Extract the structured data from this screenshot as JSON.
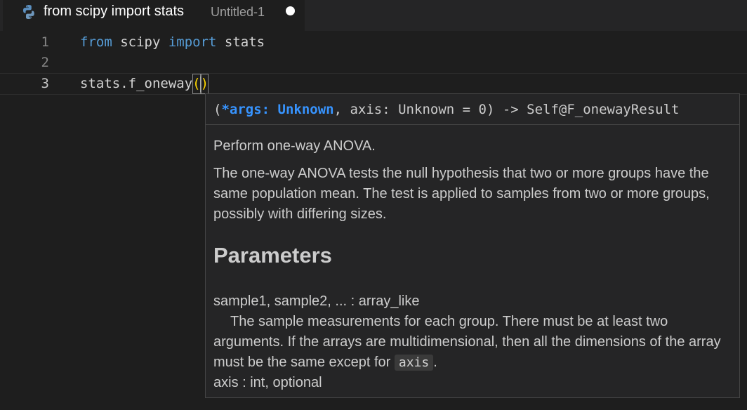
{
  "tab": {
    "title": "from scipy import stats",
    "description": "Untitled-1",
    "icon": "python-icon",
    "dirty": true
  },
  "editor": {
    "lines": [
      {
        "number": "1",
        "tokens": [
          {
            "text": "from",
            "kind": "keyword"
          },
          {
            "text": " scipy ",
            "kind": "plain"
          },
          {
            "text": "import",
            "kind": "keyword"
          },
          {
            "text": " stats",
            "kind": "plain"
          }
        ]
      },
      {
        "number": "2",
        "tokens": []
      },
      {
        "number": "3",
        "tokens": [
          {
            "text": "stats.f_oneway",
            "kind": "plain"
          },
          {
            "text": "(",
            "kind": "bracket"
          },
          {
            "text": ")",
            "kind": "bracket"
          }
        ]
      }
    ],
    "current_line": "3"
  },
  "signature_help": {
    "signature": {
      "open": "(",
      "active_param": "*args: Unknown",
      "rest": ", axis: Unknown = 0) -> Self@F_onewayResult"
    },
    "summary": "Perform one-way ANOVA.",
    "description": "The one-way ANOVA tests the null hypothesis that two or more groups have the same population mean. The test is applied to samples from two or more groups, possibly with differing sizes.",
    "parameters_heading": "Parameters",
    "param1_name": "sample1, sample2, ... : array_like",
    "param1_desc_before": "The sample measurements for each group. There must be at least two arguments. If the arrays are multidimensional, then all the dimensions of the array must be the same except for",
    "param1_code": "axis",
    "param1_desc_after": ".",
    "param2_name": "axis : int, optional"
  },
  "colors": {
    "keyword": "#569cd6",
    "bracket": "#ffd700",
    "active_param": "#3794ff"
  }
}
